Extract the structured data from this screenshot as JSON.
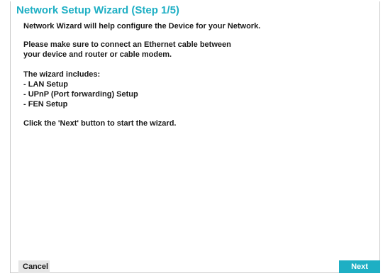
{
  "wizard": {
    "title": "Network Setup Wizard (Step 1/5)",
    "lines": [
      "Network Wizard will help configure the Device for your Network.",
      "Please make sure to connect an Ethernet cable between",
      "your device and router or cable modem.",
      "The wizard includes:",
      "- LAN Setup",
      "- UPnP (Port forwarding) Setup",
      "- FEN Setup",
      "Click the 'Next' button to start the wizard."
    ]
  },
  "buttons": {
    "cancel_label": "Cancel",
    "next_label": "Next"
  },
  "colors": {
    "accent": "#1eafc4",
    "cancel_bg": "#e6e6e6"
  }
}
